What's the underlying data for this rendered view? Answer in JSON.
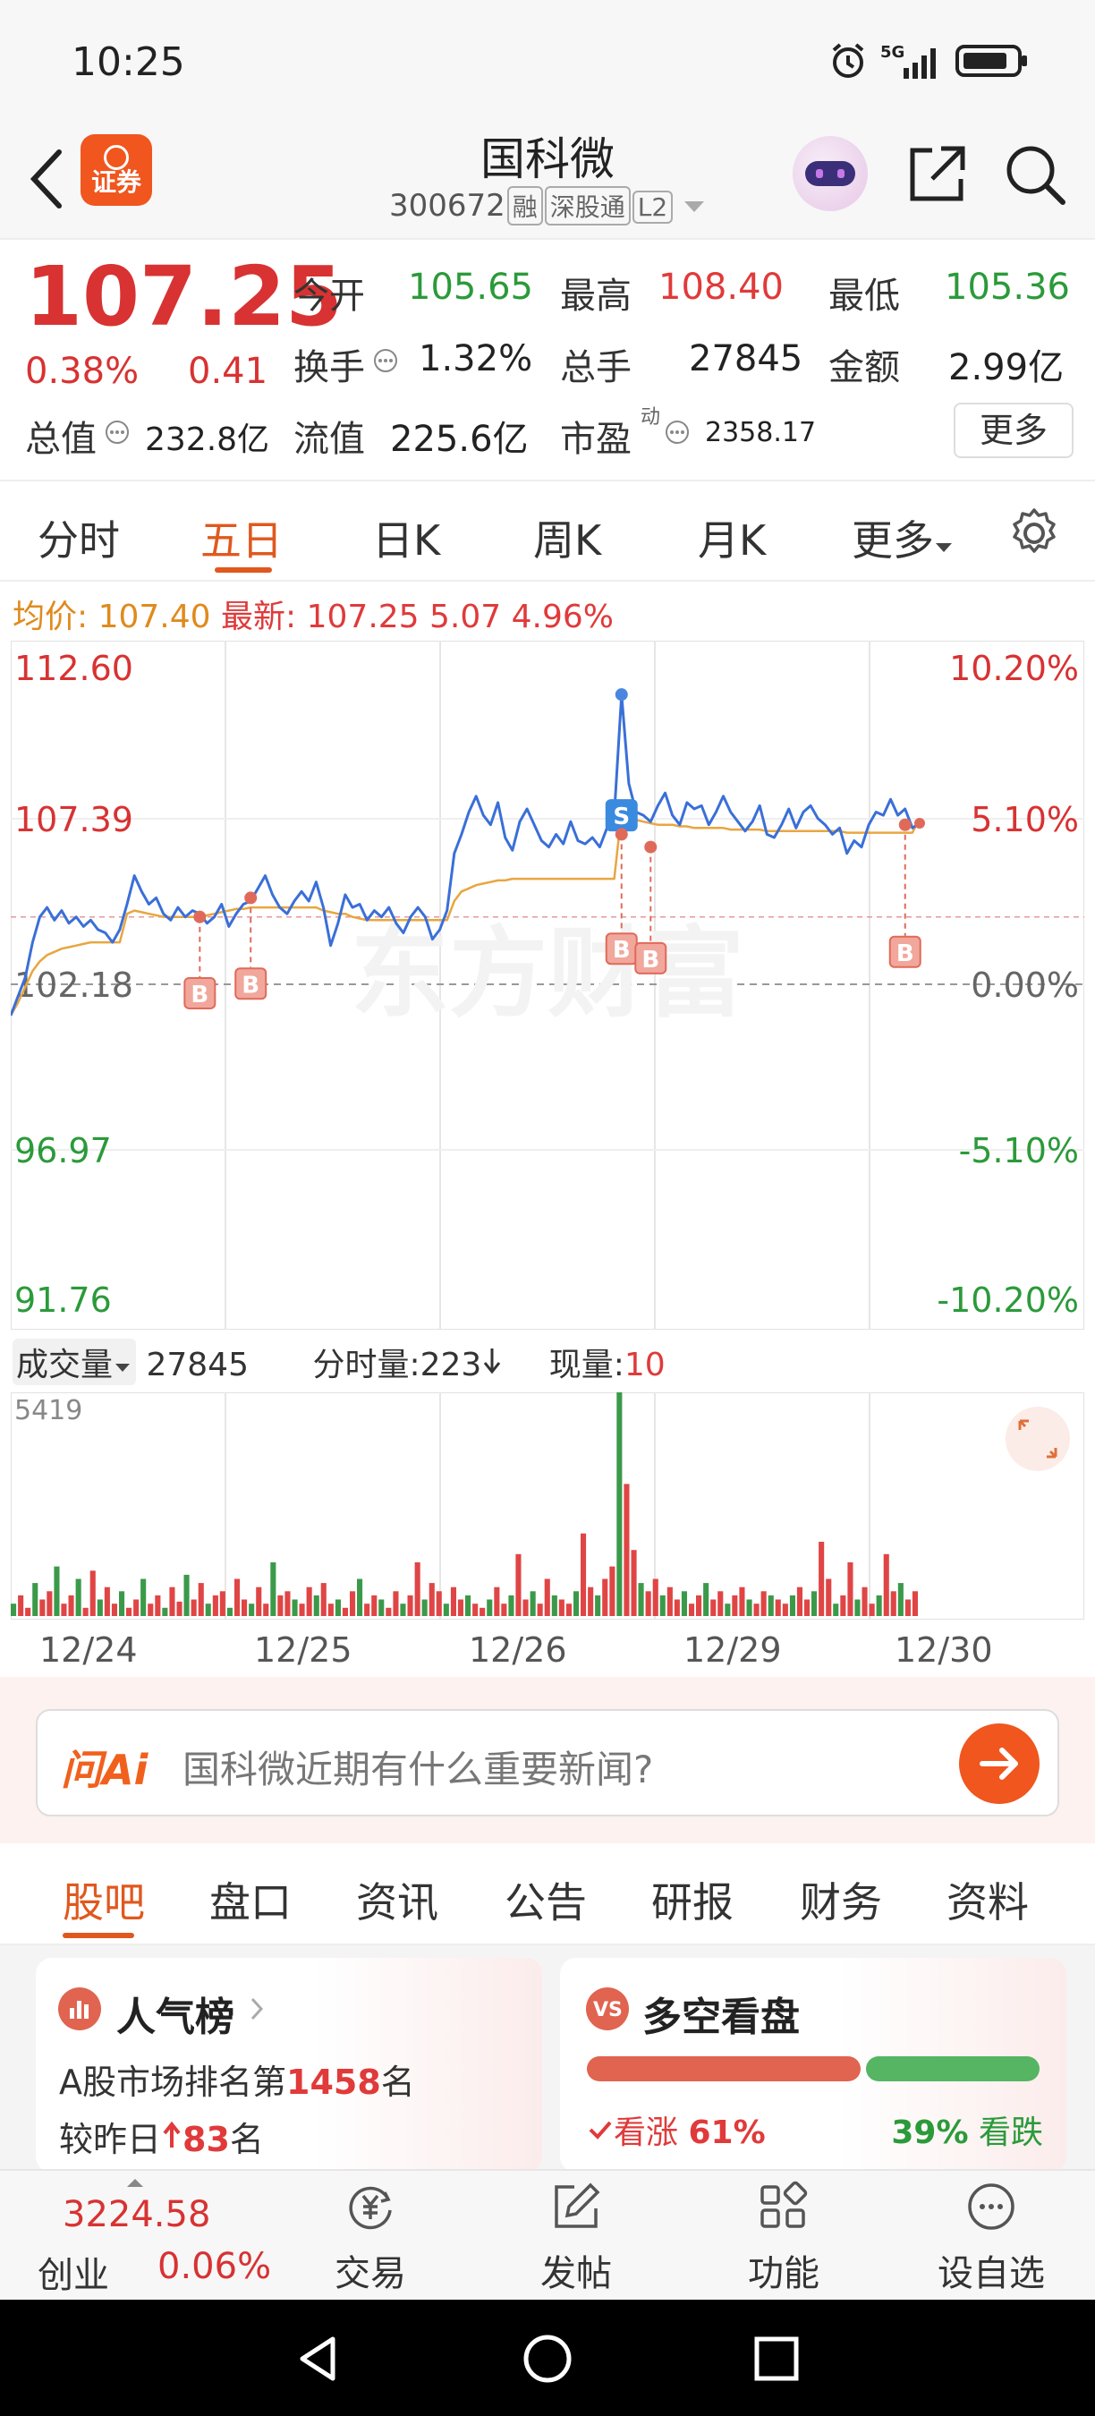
{
  "status": {
    "time": "10:25",
    "net": "5G"
  },
  "header": {
    "app_badge": "证券",
    "title": "国科微",
    "code": "300672",
    "tags": [
      "融",
      "深股通",
      "L2"
    ]
  },
  "quote": {
    "price": "107.25",
    "pct": "0.38%",
    "chg": "0.41",
    "rows": [
      [
        {
          "label": "今开",
          "value": "105.65",
          "tone": "green"
        },
        {
          "label": "最高",
          "value": "108.40",
          "tone": "red"
        },
        {
          "label": "最低",
          "value": "105.36",
          "tone": "green"
        }
      ],
      [
        {
          "label": "换手",
          "value": "1.32%",
          "tone": "dark"
        },
        {
          "label": "总手",
          "value": "27845",
          "tone": "dark"
        },
        {
          "label": "金额",
          "value": "2.99亿",
          "tone": "dark"
        }
      ]
    ],
    "total_value_label": "总值",
    "total_value": "232.8亿",
    "float_value_label": "流值",
    "float_value": "225.6亿",
    "pe_label": "市盈",
    "pe_sup": "动",
    "pe_value": "2358.17",
    "more": "更多"
  },
  "tabs": [
    "分时",
    "五日",
    "日K",
    "周K",
    "月K",
    "更多"
  ],
  "active_tab": "五日",
  "avg": {
    "avg_label": "均价:",
    "avg_value": "107.40",
    "latest_label": "最新:",
    "latest_value": "107.25",
    "latest_chg": "5.07",
    "latest_pct": "4.96%"
  },
  "chart_data": {
    "type": "line",
    "y_left": [
      "112.60",
      "107.39",
      "102.18",
      "96.97",
      "91.76"
    ],
    "y_right": [
      "10.20%",
      "5.10%",
      "0.00%",
      "-5.10%",
      "-10.20%"
    ],
    "ylim": [
      91.76,
      112.6
    ],
    "prev_close": 102.18,
    "days": [
      "12/24",
      "12/25",
      "12/26",
      "12/29",
      "12/30"
    ],
    "series": [
      {
        "values": [
          101.2,
          101.8,
          102.4,
          103.5,
          104.3,
          104.6,
          104.2,
          104.5,
          104.1,
          104.3,
          104.0,
          104.2,
          103.9,
          103.8,
          103.5,
          103.9,
          104.7,
          105.6,
          105.1,
          104.7,
          104.9,
          104.4,
          104.2,
          104.6,
          104.3,
          104.5,
          104.4,
          104.1,
          104.3,
          104.7,
          104.0,
          104.4,
          104.7,
          104.8,
          105.2,
          105.6,
          105.0,
          104.6,
          104.4,
          104.8,
          105.1,
          104.8,
          105.4,
          104.6,
          103.4,
          104.1,
          105.0,
          104.6,
          104.7,
          104.2,
          104.5,
          104.3,
          104.6,
          104.1,
          103.8,
          104.3,
          104.6,
          104.3,
          103.6,
          103.9,
          104.5,
          106.3,
          106.9,
          107.6,
          108.1,
          107.5,
          107.2,
          107.9,
          106.8,
          106.4,
          107.3,
          107.7,
          107.2,
          106.7,
          106.5,
          106.9,
          106.6,
          107.3,
          106.7,
          106.6,
          106.8,
          106.5,
          107.1,
          107.5,
          111.3,
          108.5,
          107.6,
          107.5,
          107.3,
          107.8,
          108.2,
          107.5,
          107.2,
          107.9,
          107.7,
          107.8,
          107.2,
          107.6,
          108.1,
          107.6,
          107.3,
          107.0,
          107.3,
          107.8,
          106.9,
          106.8,
          107.2,
          107.7,
          107.1,
          107.6,
          107.8,
          107.4,
          107.2,
          106.9,
          107.1,
          106.3,
          106.7,
          106.5,
          107.2,
          107.6,
          107.5,
          108.0,
          107.5,
          107.7,
          107.1,
          107.25
        ],
        "line_color": "#3a6fd8"
      },
      {
        "values": [
          101.2,
          101.6,
          102.1,
          102.6,
          102.9,
          103.1,
          103.2,
          103.3,
          103.35,
          103.4,
          103.45,
          103.5,
          103.5,
          103.5,
          103.5,
          103.5,
          104.4,
          104.5,
          104.45,
          104.4,
          104.35,
          104.3,
          104.3,
          104.3,
          104.3,
          104.3,
          104.3,
          104.35,
          104.4,
          104.45,
          104.5,
          104.55,
          104.55,
          104.6,
          104.6,
          104.6,
          104.6,
          104.6,
          104.6,
          104.6,
          104.6,
          104.6,
          104.6,
          104.5,
          104.45,
          104.4,
          104.4,
          104.3,
          104.25,
          104.2,
          104.2,
          104.2,
          104.2,
          104.2,
          104.2,
          104.2,
          104.2,
          104.2,
          104.2,
          104.2,
          104.2,
          104.8,
          105.1,
          105.2,
          105.3,
          105.35,
          105.4,
          105.45,
          105.45,
          105.5,
          105.5,
          105.5,
          105.5,
          105.5,
          105.5,
          105.5,
          105.5,
          105.5,
          105.5,
          105.5,
          105.5,
          105.5,
          105.5,
          105.5,
          107.6,
          107.45,
          107.35,
          107.3,
          107.25,
          107.2,
          107.2,
          107.2,
          107.15,
          107.15,
          107.1,
          107.1,
          107.1,
          107.1,
          107.1,
          107.05,
          107.05,
          107.05,
          107.05,
          107.05,
          107.0,
          107.0,
          107.0,
          107.0,
          107.0,
          107.0,
          107.0,
          107.0,
          107.0,
          107.0,
          107.0,
          106.95,
          106.95,
          106.95,
          106.95,
          106.95,
          106.95,
          106.95,
          106.95,
          106.95,
          106.95,
          107.4
        ],
        "line_color": "#e8a640"
      }
    ],
    "markers": [
      {
        "label": "B",
        "color": "#e06a5a",
        "dot_value": 104.3,
        "index": 26,
        "badge_value": 101.9
      },
      {
        "label": "B",
        "color": "#e06a5a",
        "dot_value": 104.9,
        "index": 33,
        "badge_value": 102.2
      },
      {
        "label": "S",
        "color": "#3a8ae0",
        "dot_value": 107.5,
        "index": 84,
        "badge_value": 107.5
      },
      {
        "label": "B",
        "color": "#e06a5a",
        "dot_value": 106.9,
        "index": 84,
        "badge_value": 103.3
      },
      {
        "label": "B",
        "color": "#e06a5a",
        "dot_value": 106.5,
        "index": 88,
        "badge_value": 103.0
      },
      {
        "label": "B",
        "color": "#e06a5a",
        "dot_value": 107.2,
        "index": 123,
        "badge_value": 103.2
      }
    ],
    "watermark": "东方财富"
  },
  "volume": {
    "label": "成交量",
    "total": "27845",
    "fenshi_label": "分时量:",
    "fenshi_value": "223",
    "now_label": "现量:",
    "now_value": "10",
    "ymax_label": "5419",
    "values": [
      300,
      500,
      200,
      800,
      400,
      600,
      1200,
      300,
      500,
      900,
      200,
      1100,
      400,
      700,
      300,
      600,
      200,
      400,
      900,
      300,
      500,
      200,
      700,
      350,
      1000,
      400,
      800,
      300,
      500,
      600,
      200,
      900,
      400,
      300,
      700,
      300,
      1300,
      500,
      600,
      400,
      300,
      700,
      500,
      800,
      300,
      400,
      200,
      600,
      900,
      300,
      500,
      400,
      200,
      600,
      300,
      500,
      1300,
      400,
      800,
      600,
      300,
      700,
      400,
      500,
      300,
      200,
      400,
      700,
      300,
      500,
      1500,
      400,
      600,
      300,
      900,
      500,
      400,
      300,
      600,
      2000,
      700,
      500,
      900,
      1200,
      5419,
      3200,
      1600,
      800,
      600,
      900,
      500,
      700,
      400,
      600,
      300,
      500,
      800,
      400,
      600,
      300,
      500,
      700,
      400,
      300,
      600,
      500,
      400,
      300,
      500,
      700,
      400,
      600,
      1800,
      900,
      300,
      500,
      1300,
      400,
      700,
      300,
      500,
      1500,
      600,
      800,
      400,
      600
    ],
    "colors_note": "red/green alternating"
  },
  "ai": {
    "logo": "问Ai",
    "placeholder": "国科微近期有什么重要新闻?"
  },
  "bottom_tabs": [
    "股吧",
    "盘口",
    "资讯",
    "公告",
    "研报",
    "财务",
    "资料"
  ],
  "cards": {
    "popularity": {
      "title": "人气榜",
      "line1_pre": "A股市场排名第",
      "rank": "1458",
      "line1_post": "名",
      "line2_pre": "较昨日",
      "change": "83",
      "line2_post": "名"
    },
    "vs": {
      "title": "多空看盘",
      "bull_label": "看涨",
      "bull_pct": "61%",
      "bear_pct": "39%",
      "bear_label": "看跌",
      "bull_fraction": 0.61
    }
  },
  "nav": {
    "index_value": "3224.58",
    "index_name": "创业",
    "index_pct": "0.06%",
    "items": [
      "交易",
      "发帖",
      "功能",
      "设自选"
    ]
  }
}
